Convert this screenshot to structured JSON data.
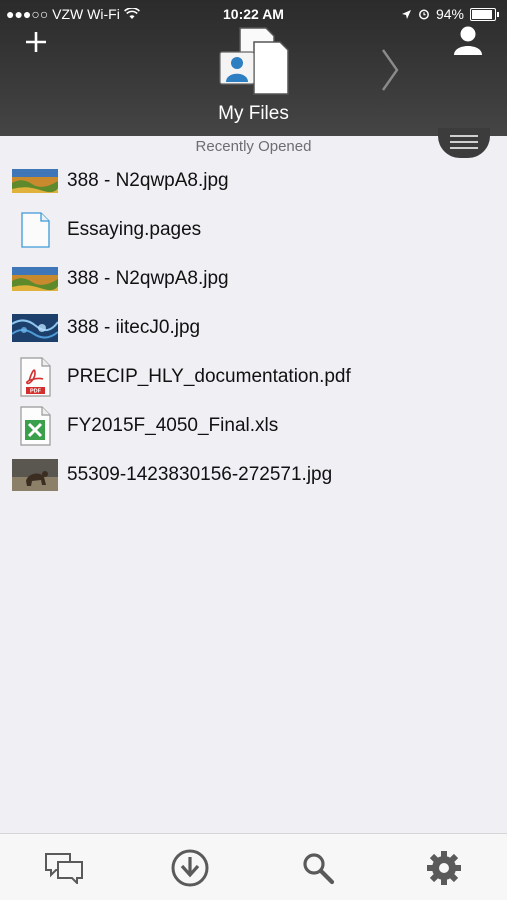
{
  "status_bar": {
    "carrier": "●●●○○ VZW Wi-Fi",
    "time": "10:22 AM",
    "battery": "94%",
    "icons": [
      "wifi-icon",
      "location-icon",
      "alarm-icon",
      "battery-icon"
    ]
  },
  "header": {
    "title": "My Files",
    "icons": [
      "add-icon",
      "my-files-icon",
      "chevron-right-icon",
      "person-icon",
      "menu-handle-icon"
    ],
    "colors": {
      "background": "#2f2f2f",
      "text": "#ffffff"
    }
  },
  "recent": {
    "label": "Recently Opened",
    "files": [
      {
        "name": "388 - N2qwpA8.jpg",
        "icon": "photo-thumbnail-landscape"
      },
      {
        "name": "Essaying.pages",
        "icon": "document-icon"
      },
      {
        "name": "388 - N2qwpA8.jpg",
        "icon": "photo-thumbnail-landscape"
      },
      {
        "name": "388 - iitecJ0.jpg",
        "icon": "photo-thumbnail-blue"
      },
      {
        "name": "PRECIP_HLY_documentation.pdf",
        "icon": "pdf-icon"
      },
      {
        "name": "FY2015F_4050_Final.xls",
        "icon": "excel-icon"
      },
      {
        "name": "55309-1423830156-272571.jpg",
        "icon": "photo-thumbnail-animal"
      }
    ]
  },
  "tabbar": {
    "icons": [
      "chat-icon",
      "download-icon",
      "search-icon",
      "gear-icon"
    ],
    "colors": {
      "icon": "#5a5a5a"
    }
  }
}
